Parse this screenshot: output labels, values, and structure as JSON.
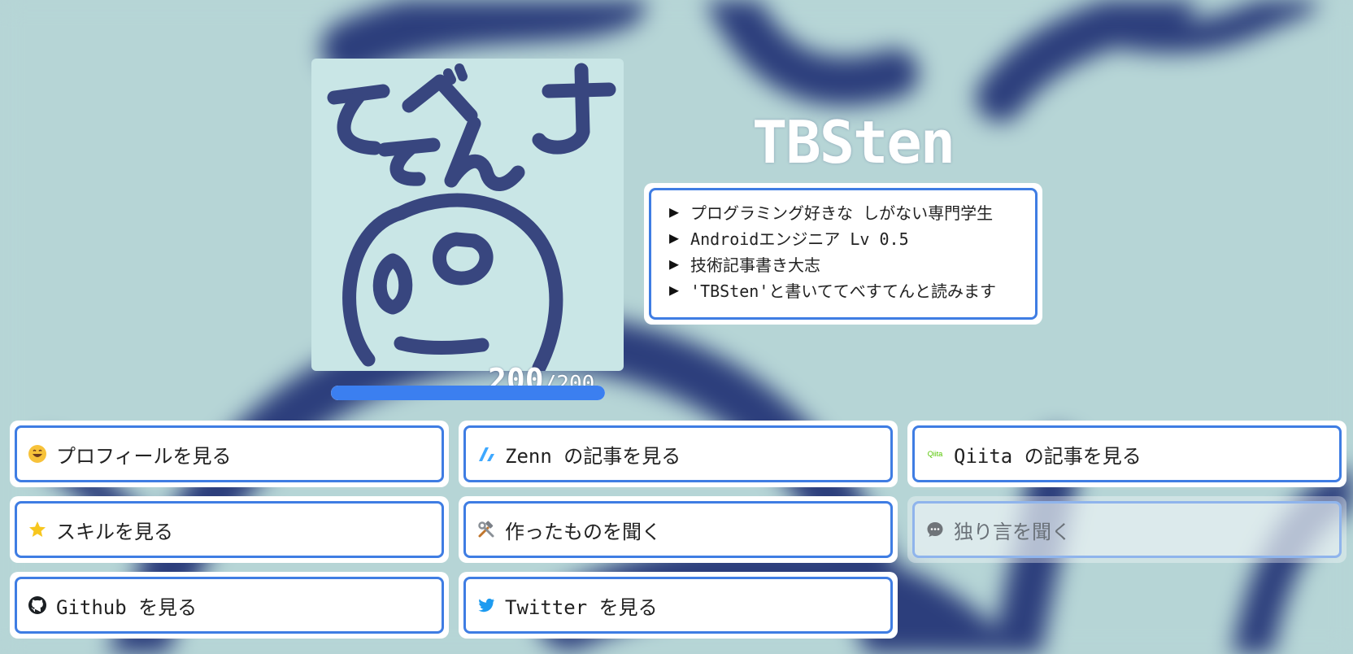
{
  "profile": {
    "name": "TBSten",
    "avatar_text": "てべんす\nてん",
    "hp_current": "200",
    "hp_max": "/200",
    "hp_ratio": 1.0
  },
  "bio": {
    "items": [
      "プログラミング好きな しがない専門学生",
      "Androidエンジニア Lv 0.5",
      "技術記事書き大志",
      "'TBSten'と書いててべすてんと読みます"
    ]
  },
  "links": {
    "profile": "プロフィールを見る",
    "zenn": "Zenn の記事を見る",
    "qiita": "Qiita の記事を見る",
    "qiita_icon_text": "Qiita",
    "skills": "スキルを見る",
    "works": "作ったものを聞く",
    "monologue": "独り言を聞く",
    "github": "Github を見る",
    "twitter": "Twitter を見る"
  },
  "colors": {
    "accent": "#3f7de3",
    "hp_fill": "#3b7ff0",
    "background": "#b6d5d6",
    "ink": "#2c3e7c"
  },
  "icons": {
    "profile": "grinning-face-icon",
    "zenn": "zenn-logo-icon",
    "qiita": "qiita-logo-icon",
    "skills": "star-icon",
    "works": "hammer-wrench-icon",
    "monologue": "speech-bubble-icon",
    "github": "github-icon",
    "twitter": "twitter-bird-icon"
  }
}
